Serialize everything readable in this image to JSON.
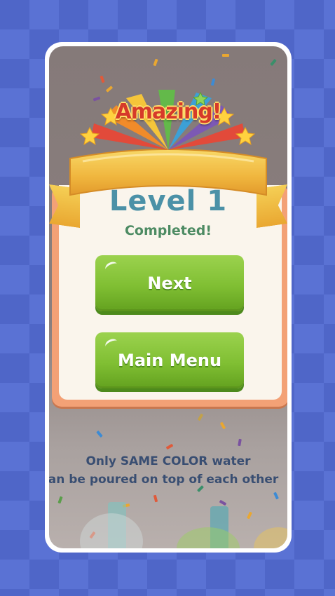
{
  "popup": {
    "banner_text": "Amazing!",
    "level_text": "Level 1",
    "status_text": "Completed!"
  },
  "buttons": {
    "next_label": "Next",
    "main_menu_label": "Main Menu"
  },
  "hint": {
    "line1": "Only SAME COLOR water",
    "line2": "can be poured on top of each other"
  },
  "colors": {
    "background": "#4f66c8",
    "button_green": "#80bf33",
    "level_text": "#4b91a7",
    "completed_text": "#4d8b63",
    "banner_text": "#d63a2a",
    "ribbon": "#f1bb42"
  },
  "icons": [
    "star-burst-icon",
    "ribbon-banner-icon",
    "confetti-icon"
  ]
}
